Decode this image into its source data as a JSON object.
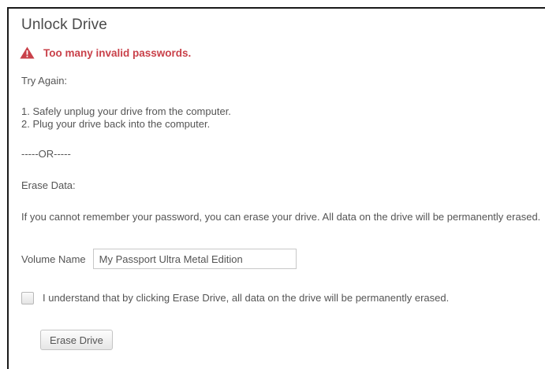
{
  "dialog": {
    "title": "Unlock Drive",
    "error": {
      "icon": "warning-triangle-icon",
      "color": "#c9414a",
      "message": "Too many invalid passwords."
    },
    "try_again_heading": "Try Again:",
    "steps": [
      "1. Safely unplug your drive from the computer.",
      "2. Plug your drive back into the computer."
    ],
    "separator": "-----OR-----",
    "erase_heading": "Erase Data:",
    "erase_description": "If you cannot remember your password, you can erase your drive. All data on the drive will be permanently erased.",
    "volume": {
      "label": "Volume Name",
      "value": "My Passport Ultra Metal Edition"
    },
    "confirm": {
      "checked": false,
      "label": "I understand that by clicking Erase Drive, all data on the drive will be permanently erased."
    },
    "erase_button_label": "Erase Drive"
  }
}
